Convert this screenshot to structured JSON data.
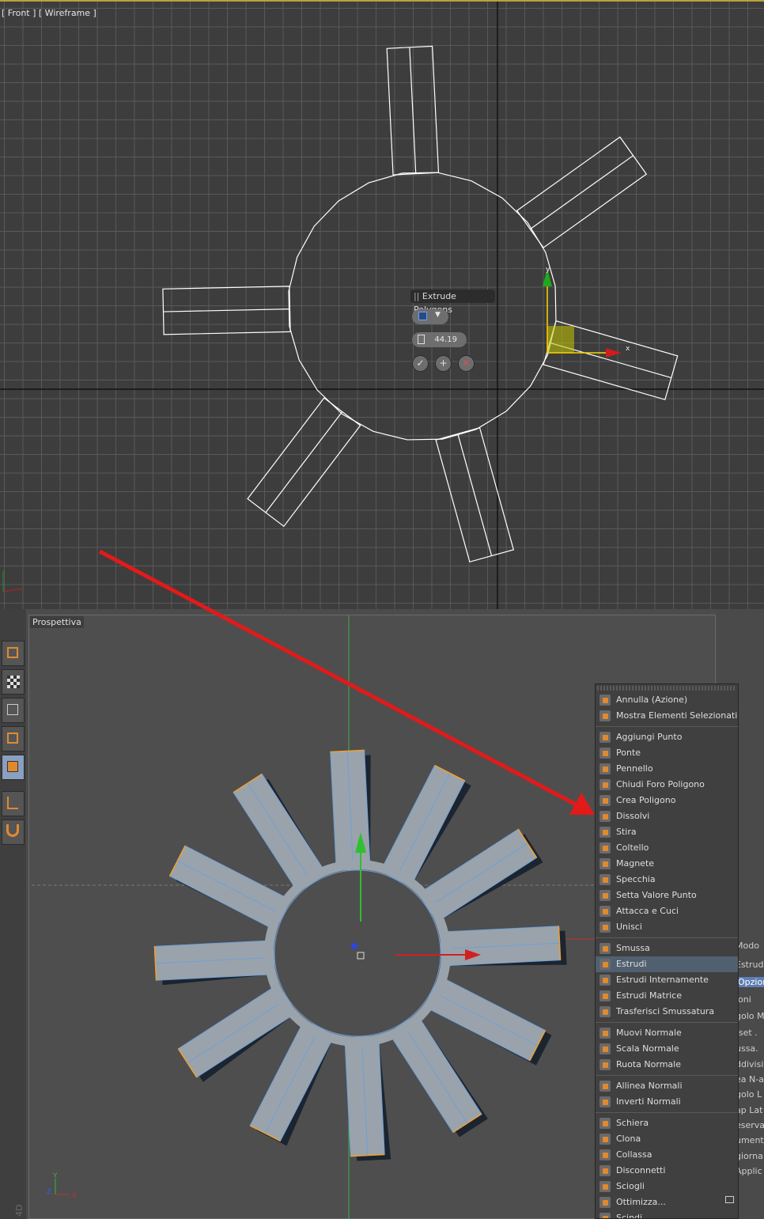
{
  "top_viewport": {
    "label": "[ Front ] [ Wireframe ]",
    "caddy": {
      "title": "Extrude Polygons",
      "amount": "44.19",
      "ok_icon": "check-icon",
      "apply_icon": "plus-icon",
      "cancel_icon": "x-icon"
    },
    "gizmo_labels": {
      "x": "x",
      "y": "y"
    }
  },
  "bottom_viewport": {
    "label": "Prospettiva",
    "axis_labels": {
      "x": "X",
      "y": "Y",
      "z": "Z"
    },
    "watermark": "4D"
  },
  "left_toolbar": {
    "items": [
      {
        "icon": "model-cube-icon"
      },
      {
        "icon": "texture-checker-icon"
      },
      {
        "icon": "points-mode-icon"
      },
      {
        "icon": "edges-mode-icon"
      },
      {
        "icon": "polygons-mode-icon",
        "active": true
      },
      {
        "icon": "axis-icon"
      },
      {
        "icon": "magnet-icon"
      }
    ]
  },
  "right_panel": {
    "items": [
      "Modo",
      "Estrud",
      "Opzion",
      "ioni",
      "golo M",
      "fset .",
      "ussa.",
      "ddivisi",
      "ea N-a",
      "golo L",
      "ap Lat",
      "eserva",
      "ument",
      "giorna",
      "Applic"
    ]
  },
  "context_menu": {
    "groups": [
      [
        {
          "label": "Annulla (Azione)",
          "icon": "undo-icon"
        },
        {
          "label": "Mostra Elementi Selezionati",
          "icon": "frame-selected-icon"
        }
      ],
      [
        {
          "label": "Aggiungi Punto",
          "icon": "add-point-icon"
        },
        {
          "label": "Ponte",
          "icon": "bridge-icon"
        },
        {
          "label": "Pennello",
          "icon": "brush-icon"
        },
        {
          "label": "Chiudi Foro Poligono",
          "icon": "close-hole-icon"
        },
        {
          "label": "Crea Poligono",
          "icon": "create-polygon-icon"
        },
        {
          "label": "Dissolvi",
          "icon": "dissolve-icon"
        },
        {
          "label": "Stira",
          "icon": "iron-icon"
        },
        {
          "label": "Coltello",
          "icon": "knife-icon"
        },
        {
          "label": "Magnete",
          "icon": "magnet-icon"
        },
        {
          "label": "Specchia",
          "icon": "mirror-icon"
        },
        {
          "label": "Setta Valore Punto",
          "icon": "set-point-value-icon"
        },
        {
          "label": "Attacca e Cuci",
          "icon": "stitch-icon"
        },
        {
          "label": "Unisci",
          "icon": "weld-icon"
        }
      ],
      [
        {
          "label": "Smussa",
          "icon": "bevel-icon"
        },
        {
          "label": "Estrudi",
          "icon": "extrude-icon",
          "selected": true
        },
        {
          "label": "Estrudi Internamente",
          "icon": "extrude-inner-icon"
        },
        {
          "label": "Estrudi Matrice",
          "icon": "matrix-extrude-icon"
        },
        {
          "label": "Trasferisci Smussatura",
          "icon": "transfer-bevel-icon"
        }
      ],
      [
        {
          "label": "Muovi Normale",
          "icon": "normal-move-icon"
        },
        {
          "label": "Scala Normale",
          "icon": "normal-scale-icon"
        },
        {
          "label": "Ruota Normale",
          "icon": "normal-rotate-icon"
        }
      ],
      [
        {
          "label": "Allinea Normali",
          "icon": "align-normals-icon"
        },
        {
          "label": "Inverti Normali",
          "icon": "reverse-normals-icon"
        }
      ],
      [
        {
          "label": "Schiera",
          "icon": "array-icon"
        },
        {
          "label": "Clona",
          "icon": "clone-icon"
        },
        {
          "label": "Collassa",
          "icon": "collapse-icon"
        },
        {
          "label": "Disconnetti",
          "icon": "disconnect-icon"
        },
        {
          "label": "Sciogli",
          "icon": "melt-icon"
        },
        {
          "label": "Ottimizza...",
          "icon": "optimize-icon"
        },
        {
          "label": "Scindi",
          "icon": "split-icon"
        }
      ]
    ]
  },
  "colors": {
    "annotation_arrow": "#e11a1a",
    "wireframe": "#ffffff",
    "mesh_fill": "#9aa3ab",
    "mesh_edge": "#6ea0d8",
    "selection_accent": "#f0a030"
  }
}
